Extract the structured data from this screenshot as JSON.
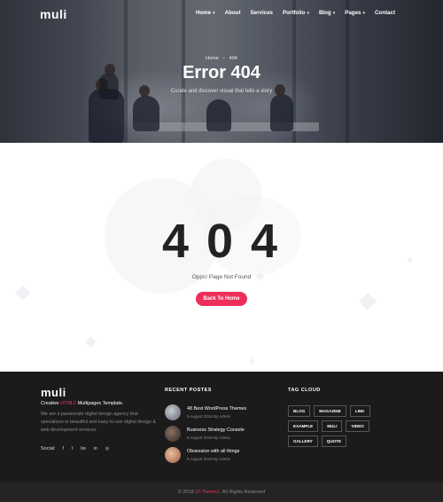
{
  "brand": {
    "logo": "muli"
  },
  "nav": {
    "items": [
      {
        "label": "Home",
        "dropdown": true
      },
      {
        "label": "About",
        "dropdown": false
      },
      {
        "label": "Services",
        "dropdown": false
      },
      {
        "label": "Portfolio",
        "dropdown": true
      },
      {
        "label": "Blog",
        "dropdown": true
      },
      {
        "label": "Pages",
        "dropdown": true
      },
      {
        "label": "Contact",
        "dropdown": false
      }
    ],
    "caret": "▾"
  },
  "hero": {
    "breadcrumb": {
      "home": "Home",
      "separator": "›",
      "current": "404"
    },
    "title": "Error 404",
    "subtitle": "Curate and discover visual that tells a story"
  },
  "error": {
    "code": "404",
    "message": "Opps! Page Not Found",
    "button": "Back To Home"
  },
  "footer": {
    "logo": "muli",
    "tagline_before": "Creative",
    "tagline_accent": "HTML5",
    "tagline_after": "Multipages Template.",
    "description": "We are a passionate digital design agency that specializes in beautiful and easy-to-use digital design & web development services.",
    "social_label": "Social:",
    "social_icons": [
      "f",
      "t",
      "be",
      "in",
      "◎"
    ],
    "recent_title": "RECENT POSTES",
    "posts": [
      {
        "title": "48 Best WordPress Themes",
        "meta": "5 August 2018 By Admin"
      },
      {
        "title": "Business Strategy Console",
        "meta": "5 August 2018 By Admin"
      },
      {
        "title": "Obsession with all things",
        "meta": "5 August 2018 By Admin"
      }
    ],
    "tags_title": "TAG CLOUD",
    "tags": [
      "BLOG",
      "MAGAZINE",
      "LINK",
      "EXAMPLE",
      "MULI",
      "VIDEO",
      "GALLERY",
      "QUOTE"
    ],
    "copyright_before": "© 2018",
    "copyright_accent": "UI-ThemeZ",
    "copyright_after": ". All Rights Reserved"
  },
  "colors": {
    "accent": "#ee2e5a",
    "footer_bg": "#1b1b1b",
    "copyright_bg": "#242424"
  }
}
